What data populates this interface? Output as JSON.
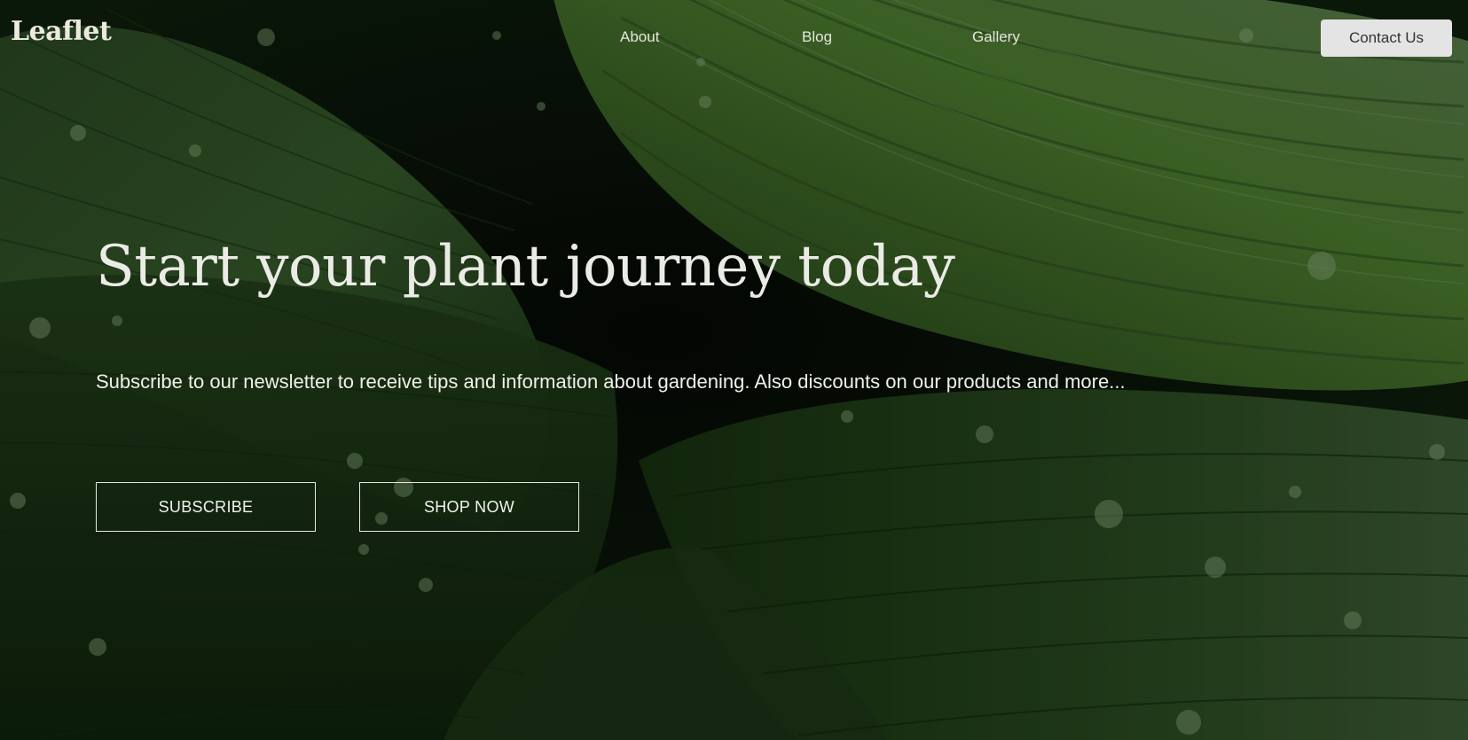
{
  "header": {
    "logo_text": "Leaflet",
    "nav": {
      "about": "About",
      "blog": "Blog",
      "gallery": "Gallery"
    },
    "contact_label": "Contact Us"
  },
  "hero": {
    "title": "Start your plant journey today",
    "subtitle": "Subscribe to our newsletter to receive tips and information about gardening. Also discounts on our products and more...",
    "subscribe_label": "SUBSCRIBE",
    "shop_label": "SHOP NOW"
  },
  "colors": {
    "background_dark": "#0b1c0b",
    "leaf_green": "#3f6b2f",
    "text_light": "#ebebe6",
    "contact_button_bg": "#e4e4e4"
  },
  "background_image": "leaf-photo"
}
